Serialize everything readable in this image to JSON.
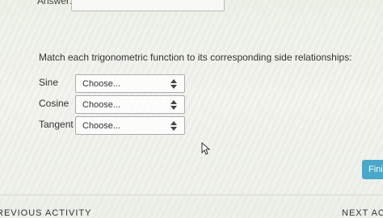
{
  "answer": {
    "label": "Answer:"
  },
  "question": {
    "prompt": "Match each trigonometric function to its corresponding side relationships:",
    "rows": [
      {
        "label": "Sine",
        "selected": "Choose..."
      },
      {
        "label": "Cosine",
        "selected": "Choose..."
      },
      {
        "label": "Tangent",
        "selected": "Choose..."
      }
    ]
  },
  "buttons": {
    "finish_label": "Finish"
  },
  "navigation": {
    "previous_label": "REVIOUS ACTIVITY",
    "next_label": "NEXT ACTIVITY"
  },
  "icons": {
    "select_arrows": "up-down-arrows-icon",
    "cursor": "mouse-pointer-icon"
  },
  "colors": {
    "finish_button": "#49a8c9"
  }
}
